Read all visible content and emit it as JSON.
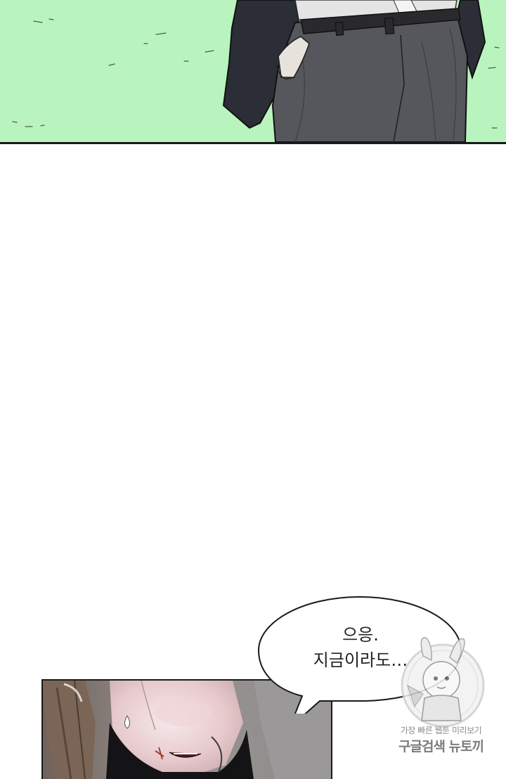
{
  "speech_bubble": {
    "line1": "으응.",
    "line2": "지금이라도…"
  },
  "watermark": {
    "line1": "가장 빠른 웹툰 미리보기",
    "line2": "구글검색 뉴토끼"
  },
  "colors": {
    "top_panel_background": "#b9f4be",
    "suit_jacket": "#2b2e36",
    "trousers": "#55575d",
    "shirt": "#e4e4e4",
    "bottom_panel_wall": "#8f8c8b",
    "border": "#1a1a1a"
  }
}
